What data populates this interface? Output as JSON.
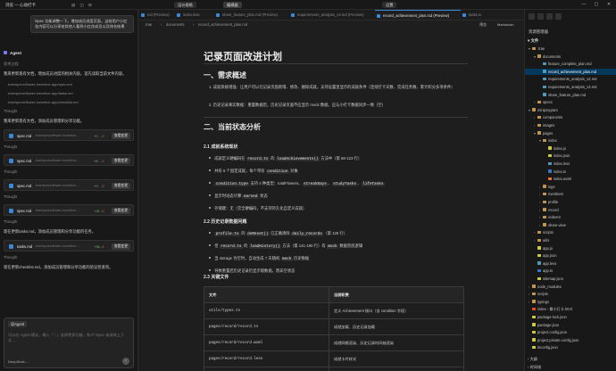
{
  "titlebar": {
    "title": "浏览 — 心动打卡",
    "top_buttons": [
      "设计规格",
      "编辑器",
      "设置"
    ],
    "window_controls": [
      "—",
      "▢",
      "✕"
    ]
  },
  "chat": {
    "user_message": "/spec 功能调整一下。增加成员进度页面，当前用户小红花内容可以分享给其他人看到小红花成员以及排名结果",
    "agent_label": "Agent",
    "entries": [
      {
        "kind": "thinking",
        "text": "思考过程"
      },
      {
        "kind": "text",
        "text": "我来更新现有文档，增加成员进度的相关内容。首先读取当前文件内容。"
      },
      {
        "kind": "path",
        "text": ".trae/specs/flower-incentive-app/spec.md"
      },
      {
        "kind": "path",
        "text": ".trae/specs/flower-incentive-app/tasks.md"
      },
      {
        "kind": "path",
        "text": ".trae/specs/flower-incentive-app/checklist.md"
      },
      {
        "kind": "thinking",
        "text": "Thought"
      },
      {
        "kind": "text",
        "text": "我来更新现有文档，添加成员管理和分享功能。"
      },
      {
        "kind": "file",
        "name": "spec.md",
        "path": ".trae/specs/flower-incentive-...",
        "add": "+0",
        "del": "-0",
        "button": "查看变更"
      },
      {
        "kind": "thinking",
        "text": "Thought"
      },
      {
        "kind": "file",
        "name": "spec.md",
        "path": ".trae/specs/flower-incentive-...",
        "add": "+8",
        "del": "-2",
        "button": "查看变更"
      },
      {
        "kind": "thinking",
        "text": "Thought"
      },
      {
        "kind": "file",
        "name": "spec.md",
        "path": ".trae/specs/flower-incentive-...",
        "add": "+9",
        "del": "-2",
        "button": "查看变更"
      },
      {
        "kind": "thinking",
        "text": "Thought"
      },
      {
        "kind": "file",
        "name": "spec.md",
        "path": ".trae/specs/flower-incentive-...",
        "add": "+31",
        "del": "-0",
        "button": "查看变更"
      },
      {
        "kind": "thinking",
        "text": "Thought"
      },
      {
        "kind": "text",
        "text": "现在更新tasks.md，添加成员管理和分享功能的任务。"
      },
      {
        "kind": "file",
        "name": "tasks.md",
        "path": ".trae/specs/flower-incentive-...",
        "add": "+36",
        "del": "-4",
        "button": "查看变更"
      },
      {
        "kind": "thinking",
        "text": "Thought"
      },
      {
        "kind": "text",
        "text": "现在更新checklist.md，添加成员管理和分享功能的验证检查项。"
      }
    ],
    "input": {
      "chip": "@Agent",
      "placeholder": "可以在 Agent 模式，输入「 / 」选择更多功能，和 #/ /spec 来选择上下文…",
      "model": "DeepSeek-…",
      "send_icon": "send-icon"
    }
  },
  "editor": {
    "tabs": [
      {
        "label": "md (Preview)",
        "active": false
      },
      {
        "label": "index.less",
        "active": false
      },
      {
        "label": "share_feature_plan.md (Preview)",
        "active": false
      },
      {
        "label": "requirements_analysis_v3.md (Preview)",
        "active": false
      },
      {
        "label": "record_achievement_plan.md (Preview)",
        "active": true
      },
      {
        "label": "tasks.m",
        "active": false
      }
    ],
    "breadcrumb": [
      ".trae",
      "documents",
      "record_achievement_plan.md"
    ],
    "crumb_buttons": [
      "预览",
      "Markdown"
    ],
    "doc": {
      "title": "记录页面改进计划",
      "s1": "一、需求概述",
      "s1_items": [
        "1. 成就系统增强：让用户可以在记录页面新增、修改、删除成就。支持设置里显示的成就条件（连续打卡天数、完成任务数、累计积分多项条件）",
        "2. 历史记录真实数据：重置数据后，历史记录页面不应显示 mock 数据，应与小打卡数据同步一致（空）"
      ],
      "s2": "二、当前状态分析",
      "s21": "2.1 成就系统现状",
      "s21_items": [
        "成就定义硬编码在 record.ts 的 loadAchievements() 方法中（第 68-123 行）",
        "共有 6 个固定成就，每个带有 condition 对象",
        "condition.type 支持 4 种类型：totalFlowers、streakDays、studyTasks、lifeTasks",
        "显示时动态计算 earned 状态",
        "存储键：无（完全硬编码，不支持持久化自定义成就）"
      ],
      "s22": "2.2 历史记录数据问题",
      "s22_items": [
        "profile.ts 的 doReset() 已正确清除 daily_records（第 125 行）",
        "但 record.ts 的 loadHistory() 方法（第 141-190 行）有 mock 数据兜底逻辑",
        "当 storage 为空时，自动生成 7 天随机 mock 历史数据",
        "导致重置后历史记录仍显示假数据，而非空状态"
      ],
      "s23": "2.3 关键文件",
      "table_headers": [
        "文件",
        "当前职责"
      ],
      "table_rows": [
        [
          "utils/types.ts",
          "定义 Achievement 接口（含 condition 字段）"
        ],
        [
          "pages/record/record.ts",
          "成就加载、历史记录加载"
        ],
        [
          "pages/record/record.wxml",
          "成就网格渲染、历史记录时间轴渲染"
        ],
        [
          "pages/record/record.less",
          "成就卡片样式"
        ],
        [
          "pages/profile/profile.ts",
          "重置功能（清除所有数据）"
        ]
      ]
    }
  },
  "explorer": {
    "header": "资源管理器",
    "section": "文件",
    "items": [
      {
        "label": ".trae",
        "depth": 0,
        "type": "folder",
        "open": true
      },
      {
        "label": "documents",
        "depth": 1,
        "type": "folder",
        "open": true
      },
      {
        "label": "feature_complete_plan.md",
        "depth": 2,
        "type": "md"
      },
      {
        "label": "record_achievement_plan.md",
        "depth": 2,
        "type": "md",
        "selected": true
      },
      {
        "label": "requirements_analysis_v2.md",
        "depth": 2,
        "type": "md"
      },
      {
        "label": "requirements_analysis_v3.md",
        "depth": 2,
        "type": "md"
      },
      {
        "label": "share_feature_plan.md",
        "depth": 2,
        "type": "md"
      },
      {
        "label": "specs",
        "depth": 1,
        "type": "folder",
        "open": false
      },
      {
        "label": "miniprogram",
        "depth": 0,
        "type": "folder",
        "open": true
      },
      {
        "label": "components",
        "depth": 1,
        "type": "folder",
        "open": false
      },
      {
        "label": "images",
        "depth": 1,
        "type": "folder",
        "open": false
      },
      {
        "label": "pages",
        "depth": 1,
        "type": "folder",
        "open": true
      },
      {
        "label": "index",
        "depth": 2,
        "type": "folder",
        "open": true
      },
      {
        "label": "index.js",
        "depth": 3,
        "type": "js"
      },
      {
        "label": "index.json",
        "depth": 3,
        "type": "json"
      },
      {
        "label": "index.less",
        "depth": 3,
        "type": "less"
      },
      {
        "label": "index.ts",
        "depth": 3,
        "type": "ts"
      },
      {
        "label": "index.wxml",
        "depth": 3,
        "type": "wxml"
      },
      {
        "label": "logs",
        "depth": 2,
        "type": "folder",
        "open": false
      },
      {
        "label": "members",
        "depth": 2,
        "type": "folder",
        "open": false
      },
      {
        "label": "profile",
        "depth": 2,
        "type": "folder",
        "open": false
      },
      {
        "label": "record",
        "depth": 2,
        "type": "folder",
        "open": false
      },
      {
        "label": "redeem",
        "depth": 2,
        "type": "folder",
        "open": false
      },
      {
        "label": "share-view",
        "depth": 2,
        "type": "folder",
        "open": false
      },
      {
        "label": "scripts",
        "depth": 1,
        "type": "folder",
        "open": false
      },
      {
        "label": "utils",
        "depth": 1,
        "type": "folder",
        "open": false
      },
      {
        "label": "app.js",
        "depth": 1,
        "type": "js"
      },
      {
        "label": "app.json",
        "depth": 1,
        "type": "json"
      },
      {
        "label": "app.less",
        "depth": 1,
        "type": "less"
      },
      {
        "label": "app.ts",
        "depth": 1,
        "type": "ts"
      },
      {
        "label": "sitemap.json",
        "depth": 1,
        "type": "json"
      },
      {
        "label": "node_modules",
        "depth": 0,
        "type": "folder",
        "open": false
      },
      {
        "label": "scripts",
        "depth": 0,
        "type": "folder",
        "open": false
      },
      {
        "label": "typings",
        "depth": 0,
        "type": "folder",
        "open": false
      },
      {
        "label": "index - 最小打卡.html",
        "depth": 0,
        "type": "html"
      },
      {
        "label": "package-lock.json",
        "depth": 0,
        "type": "json"
      },
      {
        "label": "package.json",
        "depth": 0,
        "type": "json"
      },
      {
        "label": "project.config.json",
        "depth": 0,
        "type": "json"
      },
      {
        "label": "project.private.config.json",
        "depth": 0,
        "type": "json"
      },
      {
        "label": "tsconfig.json",
        "depth": 0,
        "type": "json"
      }
    ],
    "footer": [
      "大纲",
      "时间线"
    ],
    "colors": {
      "md": "#519aba",
      "js": "#cbcb41",
      "json": "#cbcb41",
      "less": "#519aba",
      "ts": "#3178c6",
      "wxml": "#e37933",
      "html": "#e44d26",
      "folder": "#c09553"
    }
  }
}
